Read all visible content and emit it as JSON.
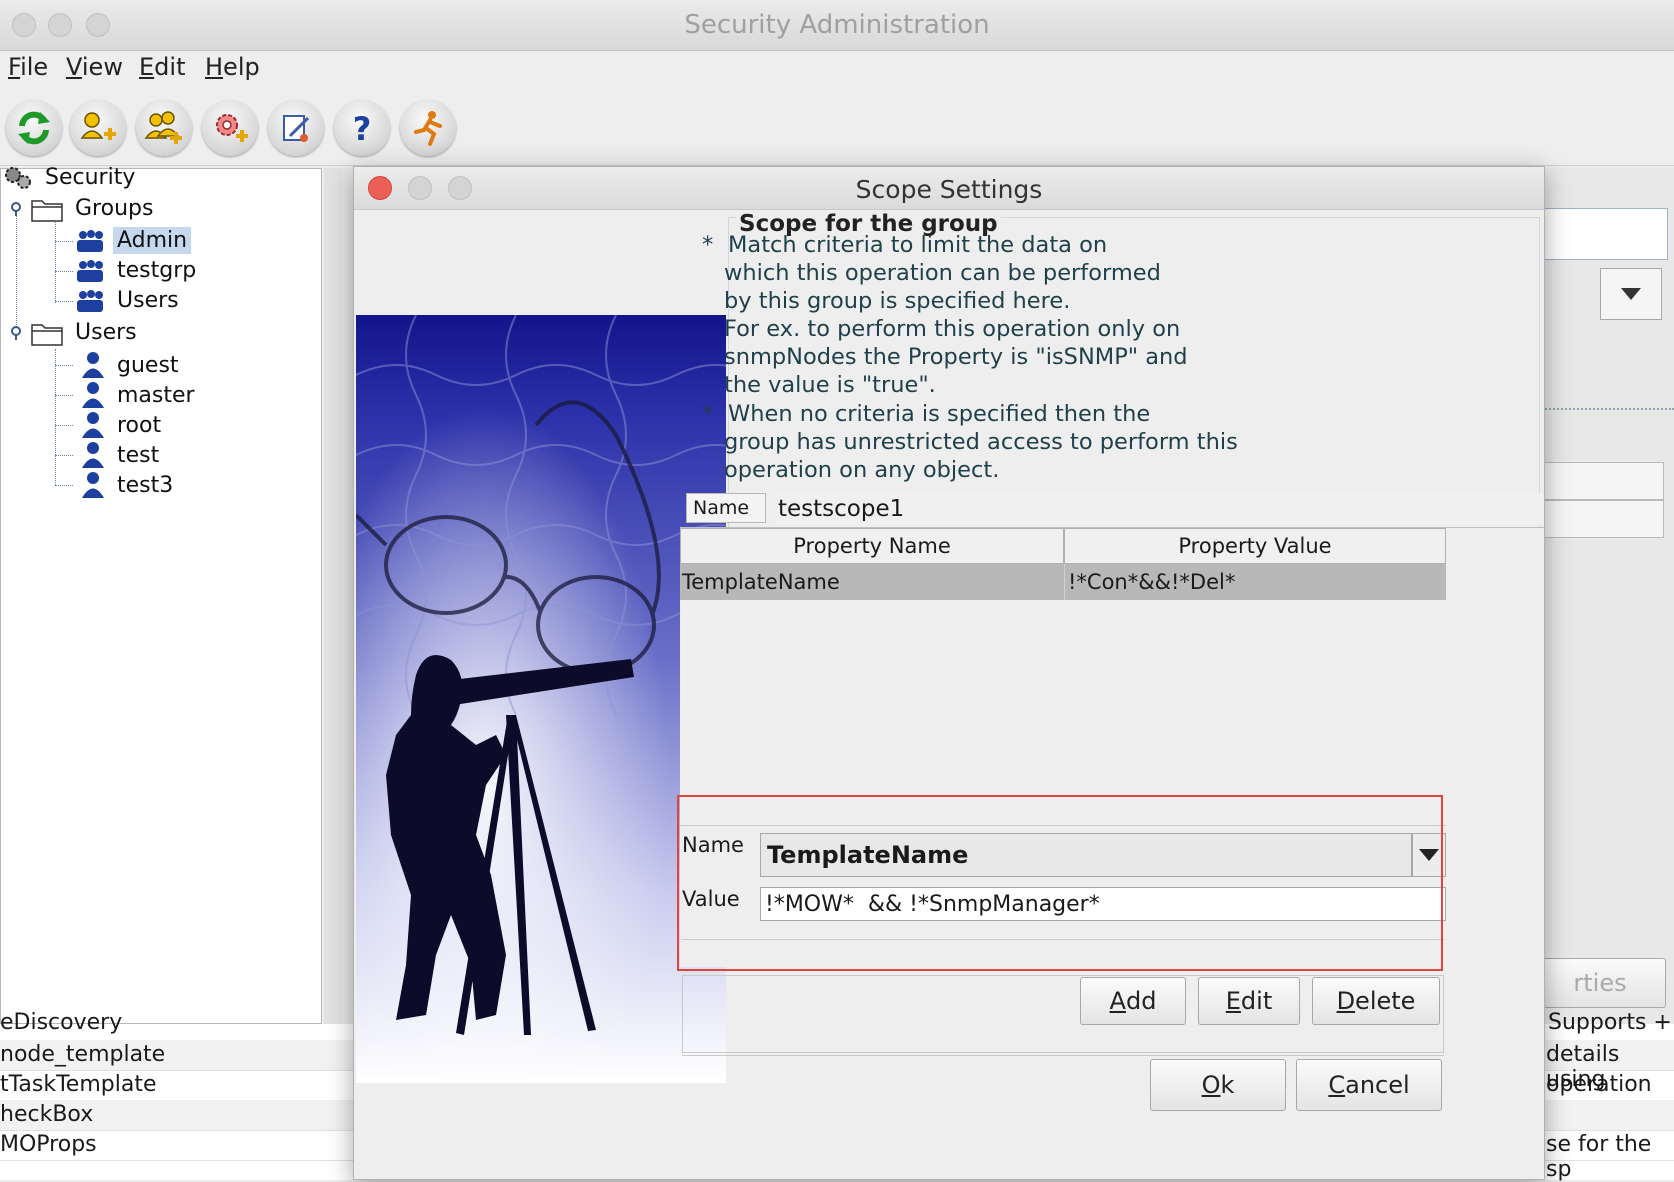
{
  "window": {
    "title": "Security Administration"
  },
  "menu": [
    {
      "key": "F",
      "rest": "ile"
    },
    {
      "key": "V",
      "rest": "iew"
    },
    {
      "key": "E",
      "rest": "dit"
    },
    {
      "key": "H",
      "rest": "elp"
    }
  ],
  "toolbar": [
    "refresh-icon",
    "add-user-icon",
    "add-group-icon",
    "add-operation-icon",
    "edit-icon",
    "help-icon",
    "exit-icon"
  ],
  "tree": {
    "root": "Security",
    "groups_label": "Groups",
    "groups": [
      "Admin",
      "testgrp",
      "Users"
    ],
    "users_label": "Users",
    "users": [
      "guest",
      "master",
      "root",
      "test",
      "test3"
    ],
    "selected": "Admin"
  },
  "background_list": {
    "left": [
      "eDiscovery",
      "node_template",
      "tTaskTemplate",
      "heckBox",
      "MOProps"
    ],
    "right": [
      "Supports +",
      "details using",
      "operation ca",
      "",
      "se for the sp"
    ],
    "right_button": "rties"
  },
  "dialog": {
    "title": "Scope Settings",
    "scope_heading": "Scope for the group",
    "info": {
      "bullet1_first": "Match criteria to limit the data on",
      "bullet1_rest": [
        "which this operation can be performed",
        "by this group is specified here.",
        "For ex. to perform this operation only on",
        "snmpNodes the Property is \"isSNMP\" and",
        "the value is \"true\"."
      ],
      "bullet2_first": "When no criteria is specified then the",
      "bullet2_rest": [
        "group has unrestricted access to perform this",
        "operation on any object."
      ],
      "bullet_mark": "*"
    },
    "scope_name_label": "Name",
    "scope_name_value": "testscope1",
    "table": {
      "headers": [
        "Property Name",
        "Property Value"
      ],
      "rows": [
        [
          "TemplateName",
          "!*Con*&&!*Del*"
        ]
      ]
    },
    "form": {
      "name_label": "Name",
      "name_selected": "TemplateName",
      "value_label": "Value",
      "value": "!*MOW*  && !*SnmpManager*"
    },
    "buttons": {
      "add": {
        "key": "A",
        "rest": "dd"
      },
      "edit": {
        "key": "E",
        "rest": "dit"
      },
      "delete": {
        "key": "D",
        "rest": "elete"
      },
      "ok": {
        "key": "O",
        "rest": "k"
      },
      "cancel": {
        "key": "C",
        "rest": "ancel"
      }
    }
  },
  "colors": {
    "highlight_box": "#e0443a",
    "selection": "#c6d8ee",
    "close_red": "#ec5f57"
  }
}
